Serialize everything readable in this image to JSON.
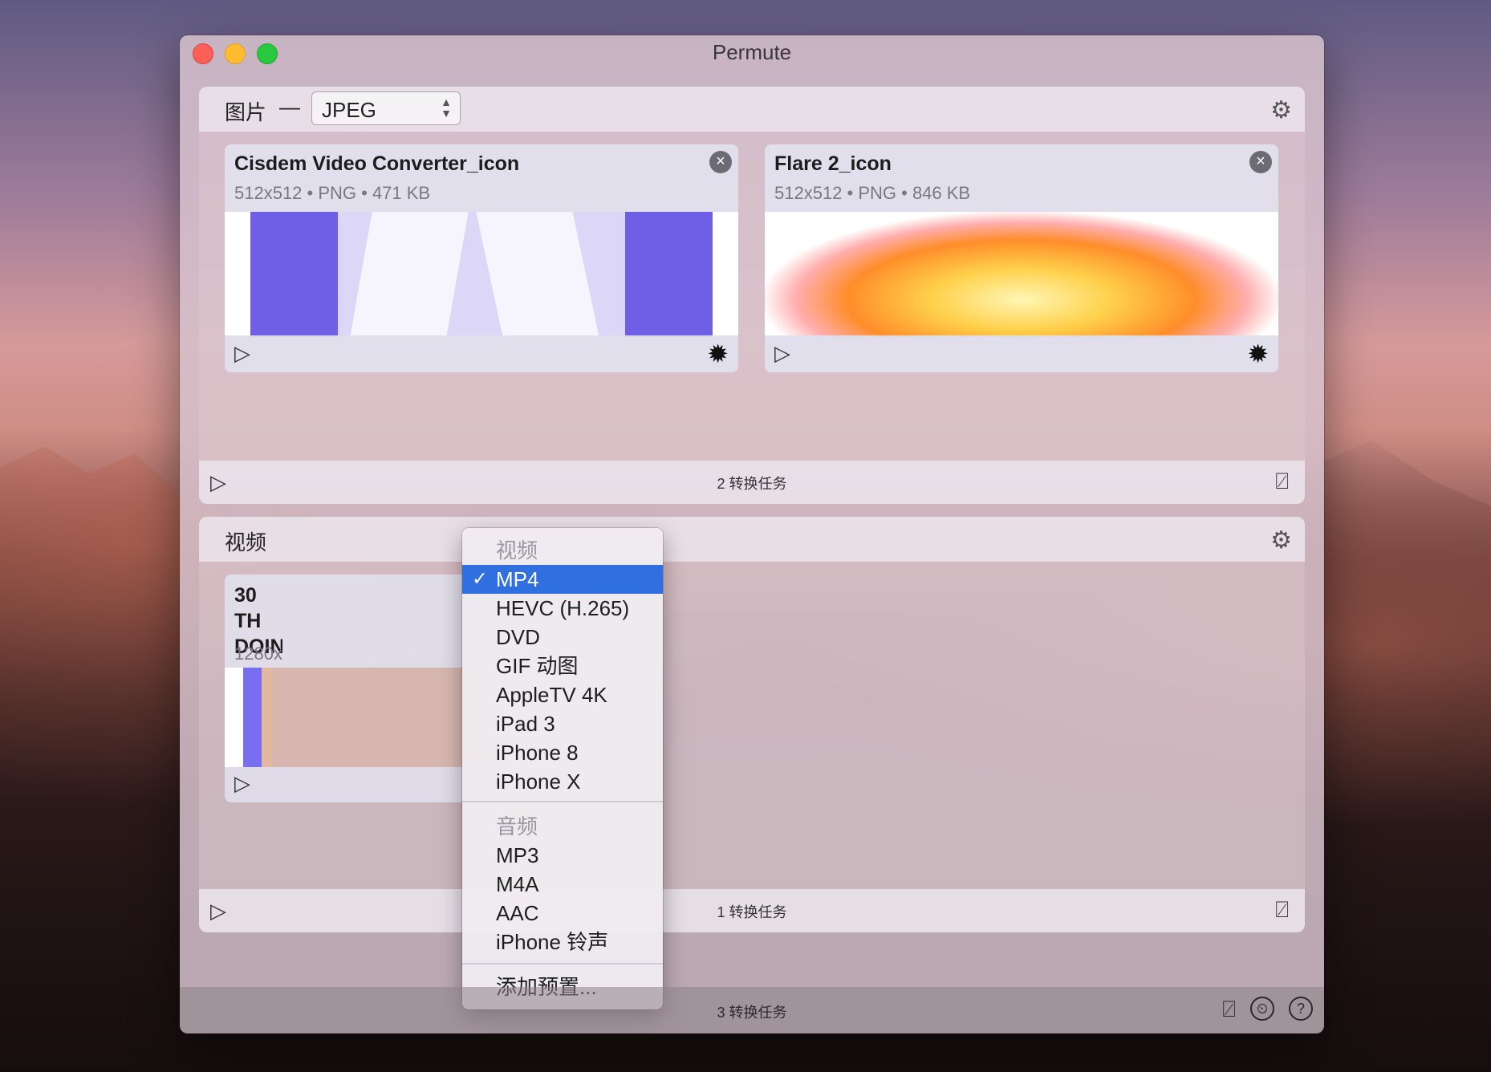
{
  "window": {
    "title": "Permute"
  },
  "image_section": {
    "label": "图片",
    "dash": "—",
    "format": "JPEG",
    "settings_icon": "gear-icon",
    "cards": [
      {
        "title": "Cisdem Video Converter_icon",
        "meta": "512x512 • PNG • 471 KB"
      },
      {
        "title": "Flare 2_icon",
        "meta": "512x512 • PNG • 846 KB"
      }
    ],
    "footer_text": "2 转换任务"
  },
  "video_section": {
    "label": "视频",
    "card": {
      "title_line1": "30 TH",
      "title_line2": "DOIN",
      "meta": "1280x"
    },
    "footer_text": "1 转换任务"
  },
  "format_menu": {
    "video_header": "视频",
    "video_items": [
      "MP4",
      "HEVC (H.265)",
      "DVD",
      "GIF 动图",
      "AppleTV 4K",
      "iPad 3",
      "iPhone 8",
      "iPhone X"
    ],
    "selected": "MP4",
    "audio_header": "音频",
    "audio_items": [
      "MP3",
      "M4A",
      "AAC",
      "iPhone 铃声"
    ],
    "add_preset": "添加预置..."
  },
  "bottom_bar": {
    "text": "3 转换任务"
  },
  "icons": {
    "close": "×",
    "play": "▷",
    "gear": "✹",
    "gear_section": "⚙",
    "clear": "⍁",
    "history": "⏲",
    "help": "?"
  }
}
